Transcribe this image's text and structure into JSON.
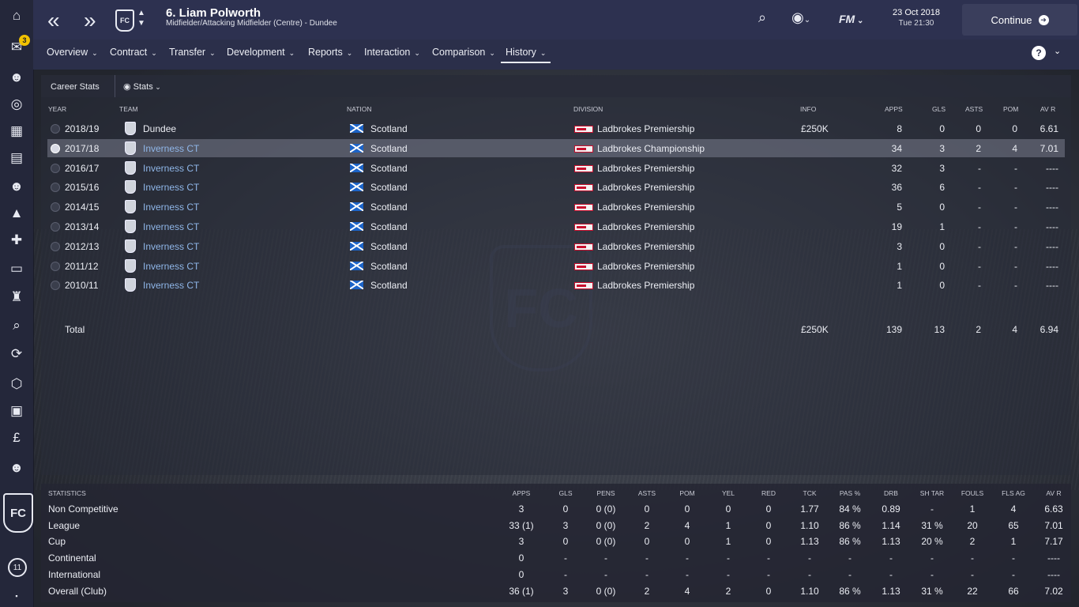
{
  "header": {
    "player_name": "6. Liam Polworth",
    "player_sub": "Midfielder/Attacking Midfielder (Centre) - Dundee",
    "date": "23 Oct 2018",
    "time": "Tue 21:30",
    "continue_label": "Continue",
    "fm_label": "FM",
    "crest_letters": "FC",
    "inbox_badge": "3",
    "squad_badge": "11"
  },
  "tabs": [
    {
      "label": "Overview"
    },
    {
      "label": "Contract"
    },
    {
      "label": "Transfer"
    },
    {
      "label": "Development"
    },
    {
      "label": "Reports"
    },
    {
      "label": "Interaction"
    },
    {
      "label": "Comparison"
    },
    {
      "label": "History",
      "active": true
    }
  ],
  "help_label": "?",
  "subbar": {
    "career_label": "Career Stats",
    "stats_label": "Stats"
  },
  "history": {
    "headers": {
      "year": "YEAR",
      "team": "TEAM",
      "nation": "NATION",
      "division": "DIVISION",
      "info": "INFO",
      "apps": "APPS",
      "gls": "GLS",
      "asts": "ASTS",
      "pom": "POM",
      "avr": "AV R"
    },
    "rows": [
      {
        "year": "2018/19",
        "team": "Dundee",
        "nation": "Scotland",
        "division": "Ladbrokes Premiership",
        "info": "£250K",
        "apps": "8",
        "gls": "0",
        "asts": "0",
        "pom": "0",
        "avr": "6.61"
      },
      {
        "year": "2017/18",
        "team": "Inverness CT",
        "nation": "Scotland",
        "division": "Ladbrokes Championship",
        "info": "",
        "apps": "34",
        "gls": "3",
        "asts": "2",
        "pom": "4",
        "avr": "7.01"
      },
      {
        "year": "2016/17",
        "team": "Inverness CT",
        "nation": "Scotland",
        "division": "Ladbrokes Premiership",
        "info": "",
        "apps": "32",
        "gls": "3",
        "asts": "-",
        "pom": "-",
        "avr": "----"
      },
      {
        "year": "2015/16",
        "team": "Inverness CT",
        "nation": "Scotland",
        "division": "Ladbrokes Premiership",
        "info": "",
        "apps": "36",
        "gls": "6",
        "asts": "-",
        "pom": "-",
        "avr": "----"
      },
      {
        "year": "2014/15",
        "team": "Inverness CT",
        "nation": "Scotland",
        "division": "Ladbrokes Premiership",
        "info": "",
        "apps": "5",
        "gls": "0",
        "asts": "-",
        "pom": "-",
        "avr": "----"
      },
      {
        "year": "2013/14",
        "team": "Inverness CT",
        "nation": "Scotland",
        "division": "Ladbrokes Premiership",
        "info": "",
        "apps": "19",
        "gls": "1",
        "asts": "-",
        "pom": "-",
        "avr": "----"
      },
      {
        "year": "2012/13",
        "team": "Inverness CT",
        "nation": "Scotland",
        "division": "Ladbrokes Premiership",
        "info": "",
        "apps": "3",
        "gls": "0",
        "asts": "-",
        "pom": "-",
        "avr": "----"
      },
      {
        "year": "2011/12",
        "team": "Inverness CT",
        "nation": "Scotland",
        "division": "Ladbrokes Premiership",
        "info": "",
        "apps": "1",
        "gls": "0",
        "asts": "-",
        "pom": "-",
        "avr": "----"
      },
      {
        "year": "2010/11",
        "team": "Inverness CT",
        "nation": "Scotland",
        "division": "Ladbrokes Premiership",
        "info": "",
        "apps": "1",
        "gls": "0",
        "asts": "-",
        "pom": "-",
        "avr": "----"
      }
    ],
    "selected_index": 1,
    "total": {
      "label": "Total",
      "info": "£250K",
      "apps": "139",
      "gls": "13",
      "asts": "2",
      "pom": "4",
      "avr": "6.94"
    }
  },
  "statistics": {
    "headers": [
      "STATISTICS",
      "APPS",
      "GLS",
      "PENS",
      "ASTS",
      "POM",
      "YEL",
      "RED",
      "TCK",
      "PAS %",
      "DRB",
      "SH TAR",
      "FOULS",
      "FLS AG",
      "AV R"
    ],
    "rows": [
      [
        "Non Competitive",
        "3",
        "0",
        "0 (0)",
        "0",
        "0",
        "0",
        "0",
        "1.77",
        "84 %",
        "0.89",
        "-",
        "1",
        "4",
        "6.63"
      ],
      [
        "League",
        "33 (1)",
        "3",
        "0 (0)",
        "2",
        "4",
        "1",
        "0",
        "1.10",
        "86 %",
        "1.14",
        "31 %",
        "20",
        "65",
        "7.01"
      ],
      [
        "Cup",
        "3",
        "0",
        "0 (0)",
        "0",
        "0",
        "1",
        "0",
        "1.13",
        "86 %",
        "1.13",
        "20 %",
        "2",
        "1",
        "7.17"
      ],
      [
        "Continental",
        "0",
        "-",
        "-",
        "-",
        "-",
        "-",
        "-",
        "-",
        "-",
        "-",
        "-",
        "-",
        "-",
        "----"
      ],
      [
        "International",
        "0",
        "-",
        "-",
        "-",
        "-",
        "-",
        "-",
        "-",
        "-",
        "-",
        "-",
        "-",
        "-",
        "----"
      ],
      [
        "Overall (Club)",
        "36 (1)",
        "3",
        "0 (0)",
        "2",
        "4",
        "2",
        "0",
        "1.10",
        "86 %",
        "1.13",
        "31 %",
        "22",
        "66",
        "7.02"
      ]
    ]
  }
}
